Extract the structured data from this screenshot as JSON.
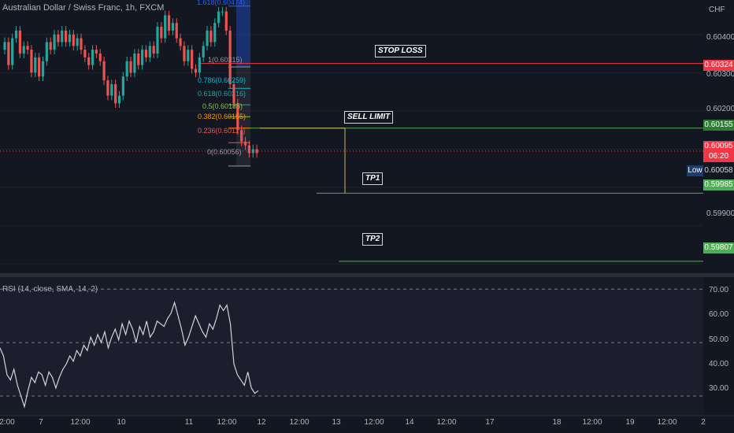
{
  "header": {
    "title": "Australian Dollar / Swiss Franc, 1h, FXCM",
    "currency": "CHF"
  },
  "rsi_title": "RSI (14, close, SMA, 14, 2)",
  "price_axis": {
    "ticks": [
      "0.60400",
      "0.60300",
      "0.60200",
      "0.59900"
    ],
    "labels": {
      "stop_loss": "0.60324",
      "sell_limit": "0.60155",
      "current": "0.60095",
      "countdown": "06:20",
      "low_tag": "Low",
      "low": "0.60058",
      "tp1": "0.59985",
      "tp2": "0.59807"
    }
  },
  "annotations": {
    "stop_loss": "STOP LOSS",
    "sell_limit": "SELL LIMIT",
    "tp1": "TP1",
    "tp2": "TP2"
  },
  "fib_levels": {
    "l1618": "1.618(0.60474)",
    "l1": "1(0.60315)",
    "l786": "0.786(0.60259)",
    "l618": "0.618(0.60216)",
    "l5": "0.5(0.60185)",
    "l382": "0.382(0.60155)",
    "l236": "0.236(0.60117)",
    "l0": "0(0.60056)"
  },
  "rsi_axis": {
    "ticks": [
      "70.00",
      "60.00",
      "50.00",
      "40.00",
      "30.00"
    ]
  },
  "time_axis": {
    "ticks": [
      "2:00",
      "7",
      "12:00",
      "10",
      "11",
      "12:00",
      "12",
      "12:00",
      "13",
      "12:00",
      "14",
      "12:00",
      "17",
      "18",
      "12:00",
      "19",
      "12:00",
      "2"
    ]
  },
  "colors": {
    "background": "#131722",
    "bull": "#26a69a",
    "bear": "#ef5350",
    "stop_loss": "#f23645",
    "target": "#4caf50",
    "rsi_line": "#d1d4dc",
    "low_tag": "#1e3a6e"
  },
  "chart_data": {
    "type": "line",
    "title": "Australian Dollar / Swiss Franc, 1h, FXCM",
    "price_levels": {
      "stop_loss": 0.60324,
      "sell_limit": 0.60155,
      "current": 0.60095,
      "low": 0.60058,
      "tp1": 0.59985,
      "tp2": 0.59807
    },
    "fibonacci": [
      {
        "ratio": 1.618,
        "price": 0.60474
      },
      {
        "ratio": 1,
        "price": 0.60315
      },
      {
        "ratio": 0.786,
        "price": 0.60259
      },
      {
        "ratio": 0.618,
        "price": 0.60216
      },
      {
        "ratio": 0.5,
        "price": 0.60185
      },
      {
        "ratio": 0.382,
        "price": 0.60155
      },
      {
        "ratio": 0.236,
        "price": 0.60117
      },
      {
        "ratio": 0,
        "price": 0.60056
      }
    ],
    "price_ylim": [
      0.5978,
      0.6049
    ],
    "rsi": {
      "ylim": [
        25,
        73
      ],
      "values": [
        48,
        45,
        38,
        36,
        40,
        34,
        30,
        26,
        32,
        37,
        35,
        39,
        38,
        34,
        39,
        37,
        33,
        37,
        40,
        42,
        45,
        43,
        47,
        45,
        49,
        47,
        52,
        49,
        53,
        50,
        54,
        48,
        52,
        55,
        51,
        57,
        53,
        58,
        55,
        50,
        56,
        53,
        58,
        52,
        54,
        58,
        57,
        56,
        59,
        61,
        65,
        60,
        55,
        49,
        52,
        56,
        60,
        57,
        54,
        52,
        57,
        55,
        59,
        64,
        62,
        64,
        57,
        42,
        38,
        36,
        34,
        39,
        33,
        31,
        32
      ]
    },
    "candles": {
      "close": [
        0.6038,
        0.6032,
        0.6039,
        0.6041,
        0.6035,
        0.6037,
        0.6036,
        0.603,
        0.6034,
        0.6029,
        0.6033,
        0.6038,
        0.6036,
        0.604,
        0.6038,
        0.6041,
        0.6038,
        0.604,
        0.6037,
        0.6039,
        0.6036,
        0.6034,
        0.6032,
        0.6036,
        0.6035,
        0.6033,
        0.6028,
        0.6024,
        0.6027,
        0.6022,
        0.6024,
        0.6029,
        0.6033,
        0.603,
        0.6035,
        0.6032,
        0.6036,
        0.6034,
        0.6037,
        0.6035,
        0.6042,
        0.6039,
        0.6045,
        0.6041,
        0.6043,
        0.6039,
        0.6037,
        0.6033,
        0.6036,
        0.6031,
        0.603,
        0.6034,
        0.6037,
        0.6041,
        0.6038,
        0.6043,
        0.6046,
        0.6046,
        0.6041,
        0.6027,
        0.6022,
        0.6015,
        0.6012,
        0.6011,
        0.6009,
        0.601,
        0.6009
      ],
      "change": [
        0.0002,
        -0.0006,
        0.0007,
        0.0002,
        -0.0006,
        0.0002,
        -0.0001,
        -0.0006,
        0.0004,
        -0.0005,
        0.0004,
        0.0005,
        -0.0002,
        0.0004,
        -0.0002,
        0.0003,
        -0.0003,
        0.0002,
        -0.0003,
        0.0002,
        -0.0003,
        -0.0002,
        -0.0002,
        0.0004,
        -0.0001,
        -0.0002,
        -0.0005,
        -0.0004,
        0.0003,
        -0.0005,
        0.0002,
        0.0005,
        0.0004,
        -0.0003,
        0.0005,
        -0.0003,
        0.0004,
        -0.0002,
        0.0003,
        -0.0002,
        0.0007,
        -0.0003,
        0.0006,
        -0.0004,
        0.0002,
        -0.0004,
        -0.0002,
        -0.0004,
        0.0003,
        -0.0005,
        -0.0001,
        0.0004,
        0.0003,
        0.0004,
        -0.0003,
        0.0005,
        0.0003,
        0.0,
        -0.0005,
        -0.0014,
        -0.0005,
        -0.0007,
        -0.0003,
        -0.0001,
        -0.0002,
        0.0001,
        -0.0001
      ]
    }
  }
}
